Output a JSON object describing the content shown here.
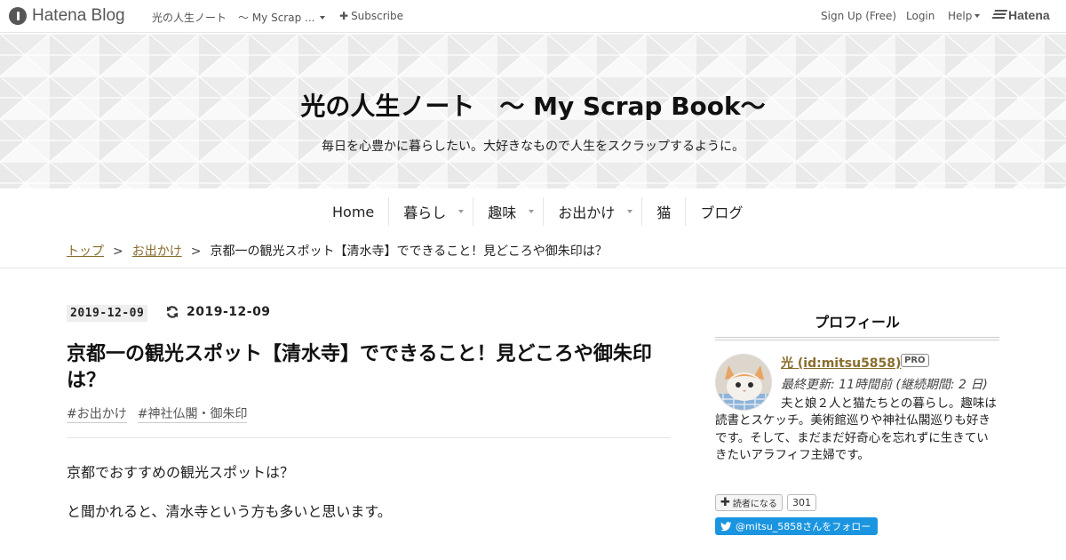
{
  "global_header": {
    "brand": "Hatena Blog",
    "blog_crumb": "光の人生ノート",
    "blog_crumb_2": "～ My Scrap ...",
    "subscribe": "Subscribe",
    "sign_up": "Sign Up (Free)",
    "login": "Login",
    "help": "Help",
    "hatena": "Hatena"
  },
  "blog_header": {
    "title": "光の人生ノート　～ My Scrap Book～",
    "description": "毎日を心豊かに暮らしたい。大好きなもので人生をスクラップするように。"
  },
  "nav": {
    "items": [
      {
        "label": "Home",
        "dropdown": false
      },
      {
        "label": "暮らし",
        "dropdown": true
      },
      {
        "label": "趣味",
        "dropdown": true
      },
      {
        "label": "お出かけ",
        "dropdown": true
      },
      {
        "label": "猫",
        "dropdown": false
      },
      {
        "label": "ブログ",
        "dropdown": false
      }
    ]
  },
  "breadcrumb": {
    "top": "トップ",
    "category": "お出かけ",
    "sep": ">",
    "current": "京都一の観光スポット【清水寺】でできること！見どころや御朱印は？"
  },
  "article": {
    "date": "2019-12-09",
    "updated_date": "2019-12-09",
    "title": "京都一の観光スポット【清水寺】でできること！見どころや御朱印は？",
    "tags": [
      "#お出かけ",
      "#神社仏閣・御朱印"
    ],
    "paragraphs": [
      "京都でおすすめの観光スポットは？",
      "と聞かれると、清水寺という方も多いと思います。"
    ]
  },
  "sidebar": {
    "section_title": "プロフィール",
    "profile_name": "光 (id:mitsu5858)",
    "pro_badge": "PRO",
    "last_updated": "最終更新: 11時間前 (継続期間: 2 日)",
    "bio": "夫と娘２人と猫たちとの暮らし。趣味は読書とスケッチ。美術館巡りや神社仏閣巡りも好きです。そして、まだまだ好奇心を忘れずに生きていきたいアラフィフ主婦です。",
    "reader_button": "読者になる",
    "reader_count": "301",
    "twitter_follow": "@mitsu_5858さんをフォロー"
  },
  "colors": {
    "link_brown": "#8a6d2d",
    "twitter_blue": "#1b95e0",
    "header_bg": "#f2f2f2"
  }
}
